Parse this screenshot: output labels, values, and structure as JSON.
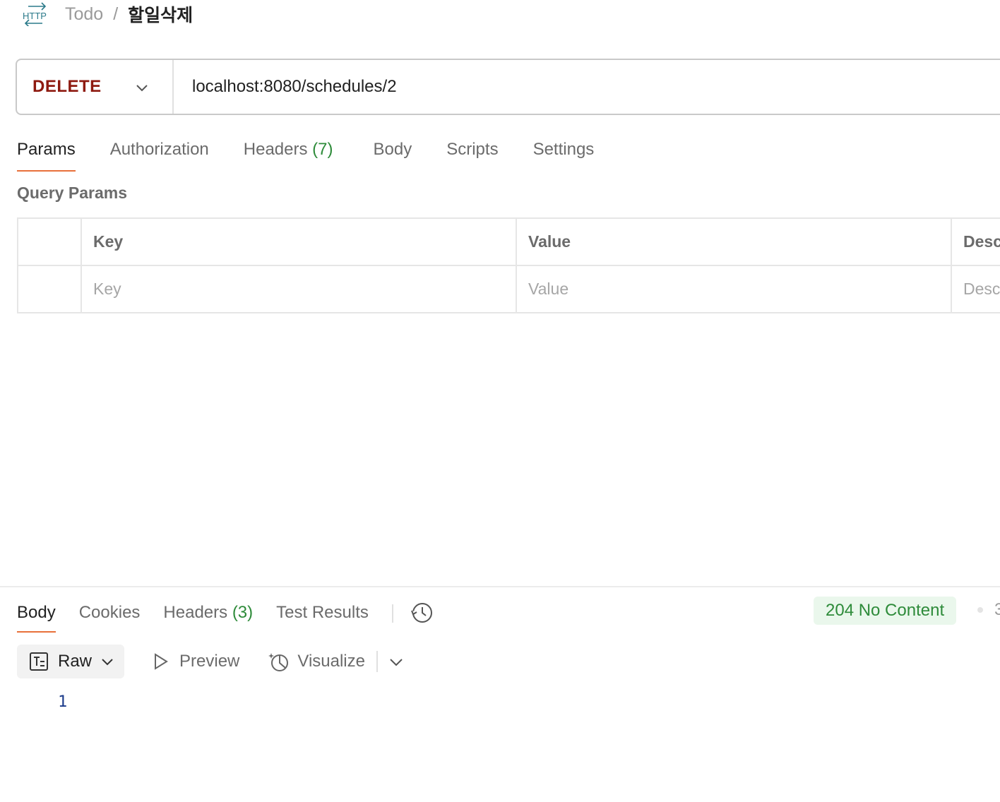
{
  "breadcrumb": {
    "icon": "http-icon",
    "parent": "Todo",
    "separator": "/",
    "current": "할일삭제"
  },
  "request": {
    "method": "DELETE",
    "url": "localhost:8080/schedules/2"
  },
  "request_tabs": [
    {
      "label": "Params",
      "active": true
    },
    {
      "label": "Authorization"
    },
    {
      "label": "Headers",
      "count": "(7)"
    },
    {
      "label": "Body"
    },
    {
      "label": "Scripts"
    },
    {
      "label": "Settings"
    }
  ],
  "query_params": {
    "title": "Query Params",
    "headers": {
      "key": "Key",
      "value": "Value",
      "description": "Desc"
    },
    "placeholders": {
      "key": "Key",
      "value": "Value",
      "description": "Desc"
    }
  },
  "response": {
    "tabs": [
      {
        "label": "Body",
        "active": true
      },
      {
        "label": "Cookies"
      },
      {
        "label": "Headers",
        "count": "(3)"
      },
      {
        "label": "Test Results"
      }
    ],
    "status": "204 No Content",
    "truncated_text": "3",
    "format": "Raw",
    "preview_label": "Preview",
    "visualize_label": "Visualize",
    "line_numbers": [
      "1"
    ]
  },
  "colors": {
    "method": "#8e1a10",
    "accent": "#e8703a",
    "success": "#2e8b3a",
    "success_bg": "#eaf7ec"
  }
}
